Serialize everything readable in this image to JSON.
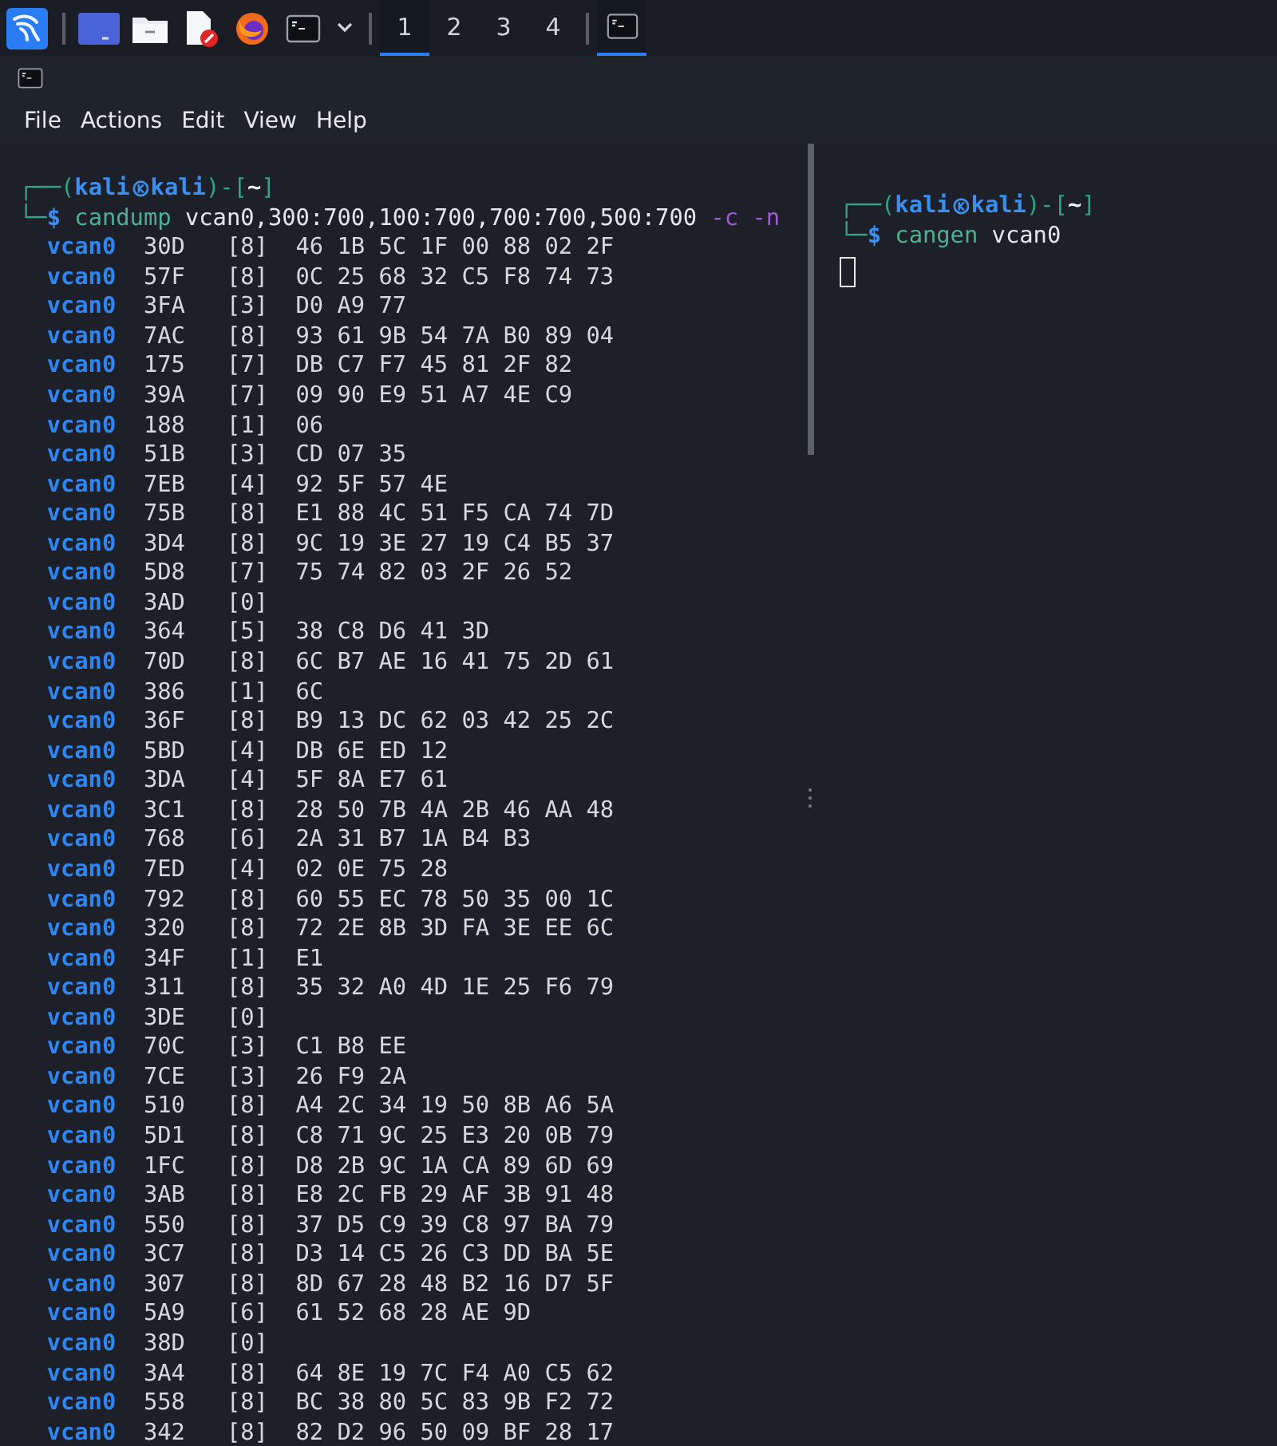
{
  "taskbar": {
    "workspaces": [
      {
        "label": "1",
        "selected": true
      },
      {
        "label": "2",
        "selected": false
      },
      {
        "label": "3",
        "selected": false
      },
      {
        "label": "4",
        "selected": false
      }
    ],
    "tasks": [
      {
        "selected": true
      }
    ]
  },
  "window": {
    "menu": [
      "File",
      "Actions",
      "Edit",
      "View",
      "Help"
    ]
  },
  "panes": [
    {
      "prompt": [
        {
          "kind": "frame",
          "text": "┌──("
        },
        {
          "kind": "user",
          "text": "kali"
        },
        {
          "kind": "at-icon"
        },
        {
          "kind": "user",
          "text": "kali"
        },
        {
          "kind": "frame",
          "text": ")-["
        },
        {
          "kind": "dir",
          "text": "~"
        },
        {
          "kind": "frame",
          "text": "]"
        }
      ],
      "command": [
        {
          "kind": "frame",
          "text": "└─"
        },
        {
          "kind": "sigil",
          "text": "$"
        },
        {
          "kind": "program",
          "text": "candump"
        },
        {
          "kind": "arg",
          "text": "vcan0,300:700,100:700,700:700,500:700"
        },
        {
          "kind": "option",
          "text": "-c -n"
        }
      ],
      "rows": [
        {
          "interface": "vcan0",
          "id": "30D",
          "dlc": "[8]",
          "data": "46 1B 5C 1F 00 88 02 2F"
        },
        {
          "interface": "vcan0",
          "id": "57F",
          "dlc": "[8]",
          "data": "0C 25 68 32 C5 F8 74 73"
        },
        {
          "interface": "vcan0",
          "id": "3FA",
          "dlc": "[3]",
          "data": "D0 A9 77"
        },
        {
          "interface": "vcan0",
          "id": "7AC",
          "dlc": "[8]",
          "data": "93 61 9B 54 7A B0 89 04"
        },
        {
          "interface": "vcan0",
          "id": "175",
          "dlc": "[7]",
          "data": "DB C7 F7 45 81 2F 82"
        },
        {
          "interface": "vcan0",
          "id": "39A",
          "dlc": "[7]",
          "data": "09 90 E9 51 A7 4E C9"
        },
        {
          "interface": "vcan0",
          "id": "188",
          "dlc": "[1]",
          "data": "06"
        },
        {
          "interface": "vcan0",
          "id": "51B",
          "dlc": "[3]",
          "data": "CD 07 35"
        },
        {
          "interface": "vcan0",
          "id": "7EB",
          "dlc": "[4]",
          "data": "92 5F 57 4E"
        },
        {
          "interface": "vcan0",
          "id": "75B",
          "dlc": "[8]",
          "data": "E1 88 4C 51 F5 CA 74 7D"
        },
        {
          "interface": "vcan0",
          "id": "3D4",
          "dlc": "[8]",
          "data": "9C 19 3E 27 19 C4 B5 37"
        },
        {
          "interface": "vcan0",
          "id": "5D8",
          "dlc": "[7]",
          "data": "75 74 82 03 2F 26 52"
        },
        {
          "interface": "vcan0",
          "id": "3AD",
          "dlc": "[0]"
        },
        {
          "interface": "vcan0",
          "id": "364",
          "dlc": "[5]",
          "data": "38 C8 D6 41 3D"
        },
        {
          "interface": "vcan0",
          "id": "70D",
          "dlc": "[8]",
          "data": "6C B7 AE 16 41 75 2D 61"
        },
        {
          "interface": "vcan0",
          "id": "386",
          "dlc": "[1]",
          "data": "6C"
        },
        {
          "interface": "vcan0",
          "id": "36F",
          "dlc": "[8]",
          "data": "B9 13 DC 62 03 42 25 2C"
        },
        {
          "interface": "vcan0",
          "id": "5BD",
          "dlc": "[4]",
          "data": "DB 6E ED 12"
        },
        {
          "interface": "vcan0",
          "id": "3DA",
          "dlc": "[4]",
          "data": "5F 8A E7 61"
        },
        {
          "interface": "vcan0",
          "id": "3C1",
          "dlc": "[8]",
          "data": "28 50 7B 4A 2B 46 AA 48"
        },
        {
          "interface": "vcan0",
          "id": "768",
          "dlc": "[6]",
          "data": "2A 31 B7 1A B4 B3"
        },
        {
          "interface": "vcan0",
          "id": "7ED",
          "dlc": "[4]",
          "data": "02 0E 75 28"
        },
        {
          "interface": "vcan0",
          "id": "792",
          "dlc": "[8]",
          "data": "60 55 EC 78 50 35 00 1C"
        },
        {
          "interface": "vcan0",
          "id": "320",
          "dlc": "[8]",
          "data": "72 2E 8B 3D FA 3E EE 6C"
        },
        {
          "interface": "vcan0",
          "id": "34F",
          "dlc": "[1]",
          "data": "E1"
        },
        {
          "interface": "vcan0",
          "id": "311",
          "dlc": "[8]",
          "data": "35 32 A0 4D 1E 25 F6 79"
        },
        {
          "interface": "vcan0",
          "id": "3DE",
          "dlc": "[0]"
        },
        {
          "interface": "vcan0",
          "id": "70C",
          "dlc": "[3]",
          "data": "C1 B8 EE"
        },
        {
          "interface": "vcan0",
          "id": "7CE",
          "dlc": "[3]",
          "data": "26 F9 2A"
        },
        {
          "interface": "vcan0",
          "id": "510",
          "dlc": "[8]",
          "data": "A4 2C 34 19 50 8B A6 5A"
        },
        {
          "interface": "vcan0",
          "id": "5D1",
          "dlc": "[8]",
          "data": "C8 71 9C 25 E3 20 0B 79"
        },
        {
          "interface": "vcan0",
          "id": "1FC",
          "dlc": "[8]",
          "data": "D8 2B 9C 1A CA 89 6D 69"
        },
        {
          "interface": "vcan0",
          "id": "3AB",
          "dlc": "[8]",
          "data": "E8 2C FB 29 AF 3B 91 48"
        },
        {
          "interface": "vcan0",
          "id": "550",
          "dlc": "[8]",
          "data": "37 D5 C9 39 C8 97 BA 79"
        },
        {
          "interface": "vcan0",
          "id": "3C7",
          "dlc": "[8]",
          "data": "D3 14 C5 26 C3 DD BA 5E"
        },
        {
          "interface": "vcan0",
          "id": "307",
          "dlc": "[8]",
          "data": "8D 67 28 48 B2 16 D7 5F"
        },
        {
          "interface": "vcan0",
          "id": "5A9",
          "dlc": "[6]",
          "data": "61 52 68 28 AE 9D"
        },
        {
          "interface": "vcan0",
          "id": "38D",
          "dlc": "[0]"
        },
        {
          "interface": "vcan0",
          "id": "3A4",
          "dlc": "[8]",
          "data": "64 8E 19 7C F4 A0 C5 62"
        },
        {
          "interface": "vcan0",
          "id": "558",
          "dlc": "[8]",
          "data": "BC 38 80 5C 83 9B F2 72"
        },
        {
          "interface": "vcan0",
          "id": "342",
          "dlc": "[8]",
          "data": "82 D2 96 50 09 BF 28 17"
        }
      ]
    },
    {
      "cursor": true,
      "prompt": [
        {
          "kind": "frame",
          "text": "┌──("
        },
        {
          "kind": "user",
          "text": "kali"
        },
        {
          "kind": "at-icon"
        },
        {
          "kind": "user",
          "text": "kali"
        },
        {
          "kind": "frame",
          "text": ")-["
        },
        {
          "kind": "dir",
          "text": "~"
        },
        {
          "kind": "frame",
          "text": "]"
        }
      ],
      "command": [
        {
          "kind": "frame",
          "text": "└─"
        },
        {
          "kind": "sigil",
          "text": "$"
        },
        {
          "kind": "program",
          "text": "cangen"
        },
        {
          "kind": "arg",
          "text": "vcan0"
        }
      ]
    }
  ]
}
